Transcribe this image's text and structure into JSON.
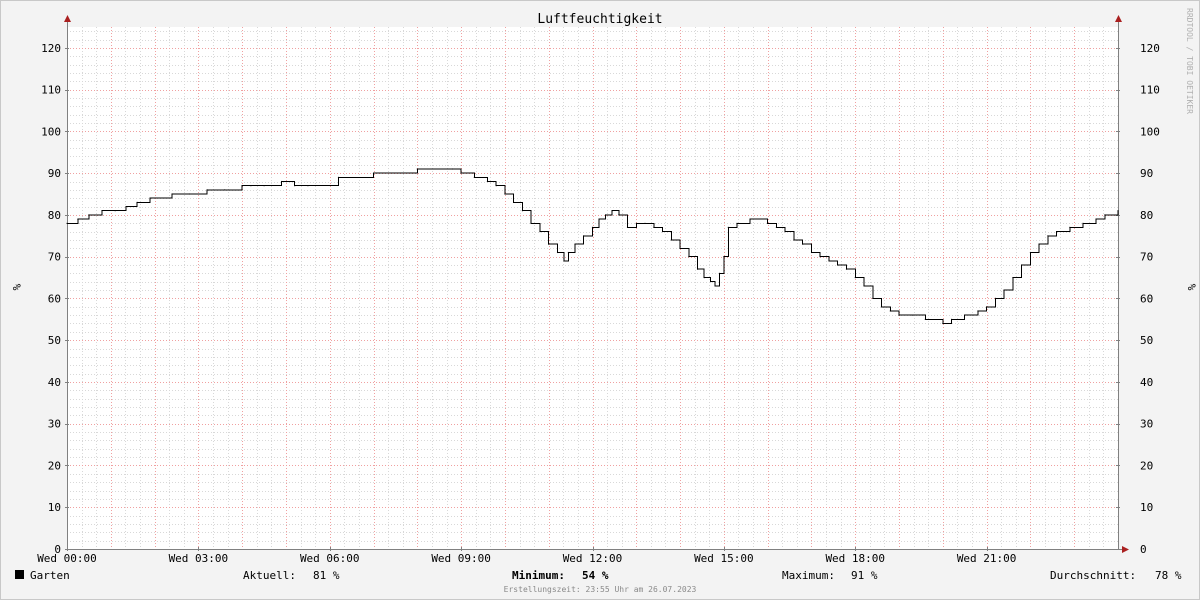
{
  "chart_data": {
    "type": "line",
    "title": "Luftfeuchtigkeit",
    "ylabel_left": "%",
    "ylabel_right": "%",
    "ylim": [
      0,
      125
    ],
    "yticks": [
      0,
      10,
      20,
      30,
      40,
      50,
      60,
      70,
      80,
      90,
      100,
      110,
      120
    ],
    "xlim_hours": [
      0,
      24
    ],
    "xticks": [
      {
        "hour": 0,
        "label": "Wed 00:00"
      },
      {
        "hour": 3,
        "label": "Wed 03:00"
      },
      {
        "hour": 6,
        "label": "Wed 06:00"
      },
      {
        "hour": 9,
        "label": "Wed 09:00"
      },
      {
        "hour": 12,
        "label": "Wed 12:00"
      },
      {
        "hour": 15,
        "label": "Wed 15:00"
      },
      {
        "hour": 18,
        "label": "Wed 18:00"
      },
      {
        "hour": 21,
        "label": "Wed 21:00"
      }
    ],
    "grid": true,
    "series": [
      {
        "name": "Garten",
        "color": "#000000",
        "x": [
          0,
          0.25,
          0.5,
          0.8,
          1.1,
          1.35,
          1.6,
          1.9,
          2.4,
          2.8,
          3.2,
          3.6,
          4.0,
          4.2,
          4.5,
          4.9,
          5.2,
          5.5,
          6.2,
          7.0,
          8.0,
          8.8,
          9.0,
          9.3,
          9.6,
          9.8,
          10.0,
          10.2,
          10.4,
          10.6,
          10.8,
          11.0,
          11.2,
          11.35,
          11.45,
          11.6,
          11.8,
          12.0,
          12.15,
          12.3,
          12.45,
          12.6,
          12.8,
          13.0,
          13.2,
          13.4,
          13.6,
          13.8,
          14.0,
          14.2,
          14.4,
          14.55,
          14.7,
          14.8,
          14.9,
          15.0,
          15.1,
          15.3,
          15.6,
          16.0,
          16.2,
          16.4,
          16.6,
          16.8,
          17.0,
          17.2,
          17.4,
          17.6,
          17.8,
          18.0,
          18.2,
          18.4,
          18.6,
          18.8,
          19.0,
          19.3,
          19.6,
          20.0,
          20.2,
          20.5,
          20.8,
          21.0,
          21.2,
          21.4,
          21.6,
          21.8,
          22.0,
          22.2,
          22.4,
          22.6,
          22.9,
          23.2,
          23.5,
          23.7,
          24.0
        ],
        "values": [
          78,
          79,
          80,
          81,
          81,
          82,
          83,
          84,
          85,
          85,
          86,
          86,
          87,
          87,
          87,
          88,
          87,
          87,
          89,
          90,
          91,
          91,
          90,
          89,
          88,
          87,
          85,
          83,
          81,
          78,
          76,
          73,
          71,
          69,
          71,
          73,
          75,
          77,
          79,
          80,
          81,
          80,
          77,
          78,
          78,
          77,
          76,
          74,
          72,
          70,
          67,
          65,
          64,
          63,
          66,
          70,
          77,
          78,
          79,
          78,
          77,
          76,
          74,
          73,
          71,
          70,
          69,
          68,
          67,
          65,
          63,
          60,
          58,
          57,
          56,
          56,
          55,
          54,
          55,
          56,
          57,
          58,
          60,
          62,
          65,
          68,
          71,
          73,
          75,
          76,
          77,
          78,
          79,
          80,
          81
        ]
      }
    ],
    "legend": {
      "series_name": "Garten",
      "aktuell_label": "Aktuell:",
      "aktuell_value": "81 %",
      "minimum_label": "Minimum:",
      "minimum_value": "54 %",
      "maximum_label": "Maximum:",
      "maximum_value": "91 %",
      "durchschnitt_label": "Durchschnitt:",
      "durchschnitt_value": "78 %"
    },
    "footer": "Erstellungszeit: 23:55 Uhr am 26.07.2023",
    "watermark": "RRDTOOL / TOBI OETIKER",
    "colors": {
      "background": "#f3f3f3",
      "plot_background": "#ffffff",
      "major_grid": "#f0a0a0",
      "minor_grid": "#d8d8d8",
      "axis": "#808080",
      "arrow": "#aa2020",
      "line": "#000000"
    }
  }
}
